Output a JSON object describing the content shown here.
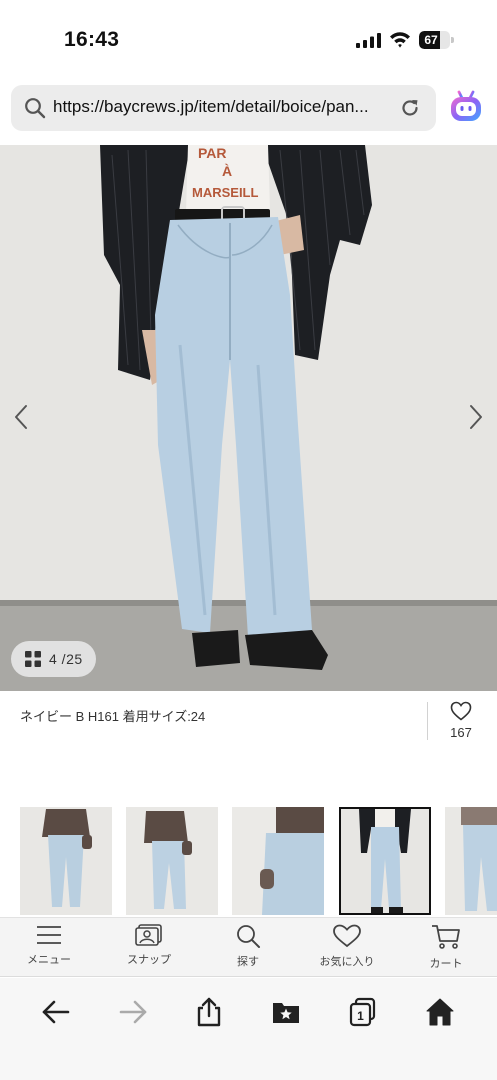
{
  "status_bar": {
    "time": "16:43",
    "battery_level": "67",
    "battery_fraction": 0.67
  },
  "browser": {
    "url": "https://baycrews.jp/item/detail/boice/pan...",
    "icons": [
      "search-icon",
      "reload-icon",
      "assistant-bot-icon"
    ]
  },
  "gallery": {
    "counter": "4 /25",
    "current": 4,
    "total": 25,
    "prev_icon": "chevron-left-icon",
    "next_icon": "chevron-right-icon",
    "shirt_print": [
      "PAR",
      "À",
      "MARSEILL"
    ]
  },
  "product": {
    "caption": "ネイビー B H161 着用サイズ:24",
    "favorite_count": "167"
  },
  "thumbnails": {
    "count_visible": 5,
    "selected_index": 3
  },
  "site_nav": {
    "items": [
      {
        "label": "メニュー",
        "icon": "menu-icon"
      },
      {
        "label": "スナップ",
        "icon": "snap-icon"
      },
      {
        "label": "探す",
        "icon": "search-icon"
      },
      {
        "label": "お気に入り",
        "icon": "heart-icon"
      },
      {
        "label": "カート",
        "icon": "cart-icon"
      }
    ]
  },
  "toolbar": {
    "icons": [
      "back-arrow-icon",
      "forward-arrow-icon",
      "share-icon",
      "bookmarks-icon",
      "tabs-icon",
      "home-icon"
    ],
    "tabs_count": "1"
  },
  "colors": {
    "denim": "#b8cfe2",
    "jacket": "#1c1e22",
    "accent_text": "#b5593a"
  }
}
